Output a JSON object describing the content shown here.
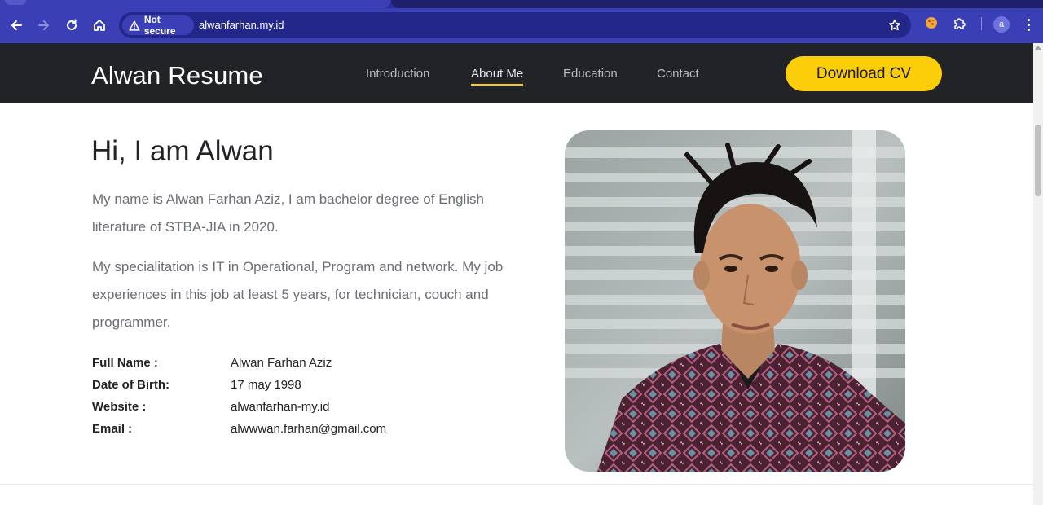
{
  "browser": {
    "security_label": "Not secure",
    "url": "alwanfarhan.my.id",
    "profile_initial": "a",
    "icons": [
      "back-arrow-icon",
      "forward-arrow-icon",
      "reload-icon",
      "home-icon",
      "warning-triangle-icon",
      "star-icon",
      "cookie-icon",
      "puzzle-icon",
      "kebab-menu-icon"
    ]
  },
  "header": {
    "brand": "Alwan Resume",
    "nav": [
      {
        "label": "Introduction",
        "active": false
      },
      {
        "label": "About Me",
        "active": true
      },
      {
        "label": "Education",
        "active": false
      },
      {
        "label": "Contact",
        "active": false
      }
    ],
    "cta_label": "Download CV",
    "accent_color": "#fccd09",
    "bg_color": "#212326"
  },
  "about": {
    "title": "Hi, I am Alwan",
    "paragraphs": [
      "My name is Alwan Farhan Aziz, I am bachelor degree of English literature of STBA-JIA in 2020.",
      "My specialitation is IT in Operational, Program and network. My job experiences in this job at least 5 years, for technician, couch and programmer."
    ],
    "info": [
      {
        "label": "Full Name :",
        "value": "Alwan Farhan Aziz"
      },
      {
        "label": "Date of Birth:",
        "value": "17 may 1998"
      },
      {
        "label": "Website :",
        "value": "alwanfarhan-my.id"
      },
      {
        "label": "Email :",
        "value": "alwwwan.farhan@gmail.com"
      }
    ]
  }
}
